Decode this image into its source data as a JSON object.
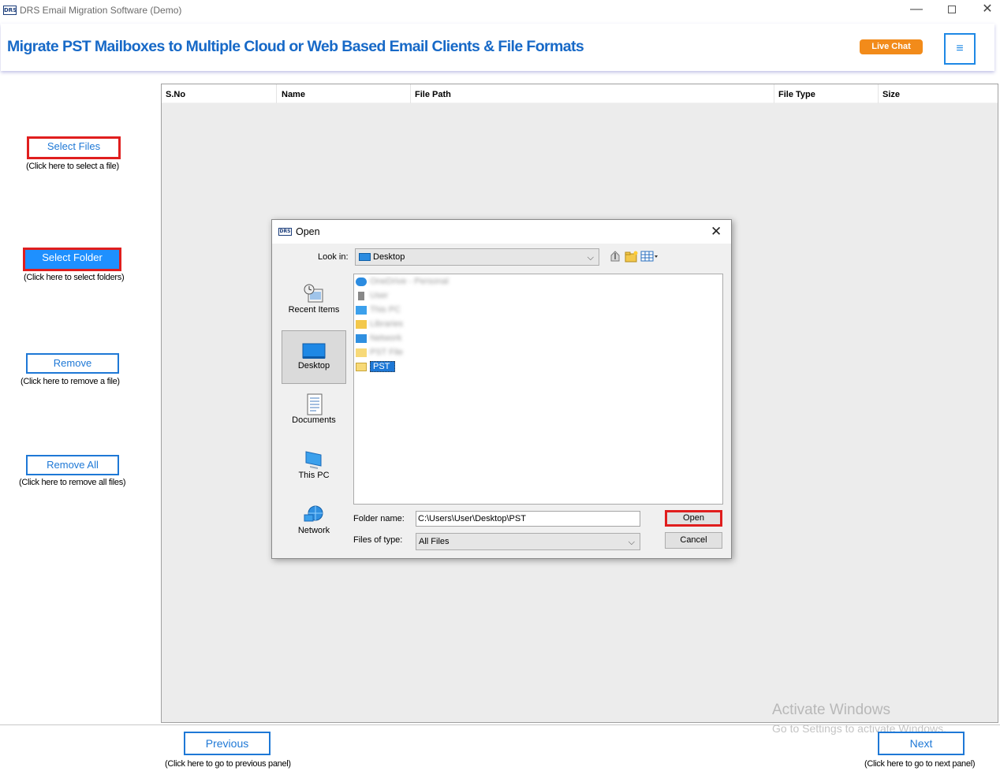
{
  "window": {
    "app_icon_text": "DRS",
    "title": "DRS Email Migration Software (Demo)",
    "minimize": "—",
    "maximize": "",
    "close": "✕"
  },
  "header": {
    "headline": "Migrate PST Mailboxes to Multiple Cloud or Web Based Email Clients & File Formats",
    "live_chat": "Live Chat",
    "menu_icon": "≡"
  },
  "sidebar": {
    "select_files": "Select Files",
    "select_files_hint": "(Click here to select a file)",
    "select_folder": "Select Folder",
    "select_folder_hint": "(Click here to select folders)",
    "remove": "Remove",
    "remove_hint": "(Click here to remove a file)",
    "remove_all": "Remove All",
    "remove_all_hint": "(Click here to remove all files)"
  },
  "table": {
    "columns": [
      "S.No",
      "Name",
      "File Path",
      "File Type",
      "Size"
    ]
  },
  "dialog": {
    "icon_text": "DRS",
    "title": "Open",
    "close": "✕",
    "look_in_label": "Look in:",
    "look_in_value": "Desktop",
    "places": [
      "Recent Items",
      "Desktop",
      "Documents",
      "This PC",
      "Network"
    ],
    "files": [
      {
        "label": "OneDrive - Personal",
        "blurred": true
      },
      {
        "label": "User",
        "blurred": true
      },
      {
        "label": "This PC",
        "blurred": true
      },
      {
        "label": "Libraries",
        "blurred": true
      },
      {
        "label": "Network",
        "blurred": true
      },
      {
        "label": "PST File",
        "blurred": true
      },
      {
        "label": "PST",
        "blurred": false
      }
    ],
    "folder_name_label": "Folder name:",
    "folder_name_value": "C:\\Users\\User\\Desktop\\PST",
    "files_of_type_label": "Files of type:",
    "files_of_type_value": "All Files",
    "open_button": "Open",
    "cancel_button": "Cancel"
  },
  "watermark": {
    "line1": "Activate Windows",
    "line2": "Go to Settings to activate Windows."
  },
  "footer": {
    "previous": "Previous",
    "previous_hint": "(Click here to go to previous panel)",
    "next": "Next",
    "next_hint": "(Click here to go to next panel)"
  },
  "colors": {
    "accent_blue": "#1e78d6",
    "headline_blue": "#1769c7",
    "live_chat_orange": "#f28b1a",
    "highlight_red": "#e01e1e"
  }
}
